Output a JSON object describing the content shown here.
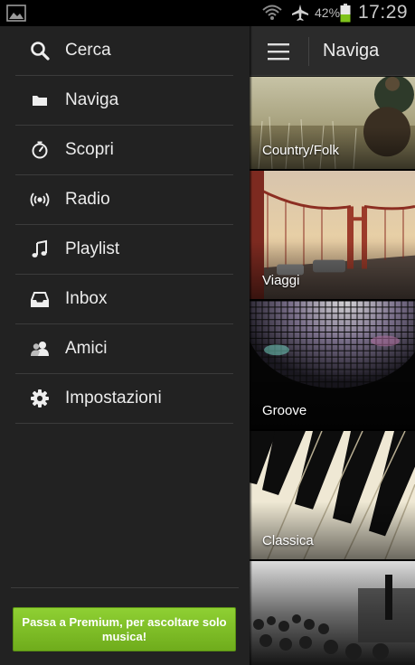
{
  "status_bar": {
    "battery_percent": "42%",
    "time": "17:29"
  },
  "drawer": {
    "items": [
      {
        "label": "Cerca",
        "icon": "search-icon"
      },
      {
        "label": "Naviga",
        "icon": "folder-icon"
      },
      {
        "label": "Scopri",
        "icon": "compass-icon"
      },
      {
        "label": "Radio",
        "icon": "radio-icon"
      },
      {
        "label": "Playlist",
        "icon": "music-note-icon"
      },
      {
        "label": "Inbox",
        "icon": "inbox-icon"
      },
      {
        "label": "Amici",
        "icon": "friends-icon"
      },
      {
        "label": "Impostazioni",
        "icon": "gear-icon"
      }
    ],
    "premium_button": "Passa a Premium, per ascoltare solo musica!"
  },
  "main": {
    "title": "Naviga",
    "tiles": [
      {
        "label": "Country/Folk"
      },
      {
        "label": "Viaggi"
      },
      {
        "label": "Groove"
      },
      {
        "label": "Classica"
      },
      {
        "label": ""
      }
    ]
  },
  "colors": {
    "accent_green": "#84c225",
    "drawer_bg": "#222222",
    "topbar_bg": "#2b2b2b"
  }
}
